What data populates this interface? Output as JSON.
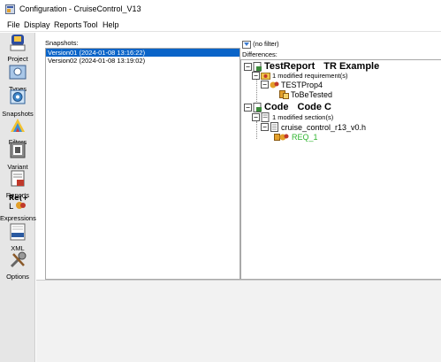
{
  "window": {
    "title": "Configuration - CruiseControl_V13"
  },
  "menu": [
    "File",
    "Display",
    "Reports",
    "Tool",
    "Help"
  ],
  "sidebar": [
    {
      "label": "Project",
      "icon": "project-icon"
    },
    {
      "label": "Types",
      "icon": "types-icon"
    },
    {
      "label": "Snapshots",
      "icon": "snapshots-icon"
    },
    {
      "label": "Filters",
      "icon": "filters-icon"
    },
    {
      "label": "Variant",
      "icon": "variant-icon"
    },
    {
      "label": "Reports",
      "icon": "reports-icon"
    },
    {
      "label": "Expressions",
      "icon": "expressions-icon"
    },
    {
      "label": "XML",
      "icon": "xml-icon"
    },
    {
      "label": "Options",
      "icon": "options-icon"
    }
  ],
  "snapshots": {
    "label": "Snapshots:",
    "items": [
      {
        "text": "Version01 (2024-01-08 13:16:22)",
        "selected": true
      },
      {
        "text": "Version02 (2024-01-08 13:19:02)",
        "selected": false
      }
    ]
  },
  "differences": {
    "filter_text": "(no filter)",
    "label": "Differences:",
    "tree": {
      "testreport": {
        "name": "TestReport",
        "suffix": "TR Example"
      },
      "req_count": "1 modified requirement(s)",
      "testprop": "TESTProp4",
      "tobetested": "ToBeTested",
      "code": {
        "name": "Code",
        "suffix": "Code C"
      },
      "sec_count": "1 modified section(s)",
      "file": "cruise_control_r13_v0.h",
      "req": "REQ_1"
    }
  },
  "colors": {
    "selection": "#0a64c8",
    "req_green": "#2fb52f"
  }
}
